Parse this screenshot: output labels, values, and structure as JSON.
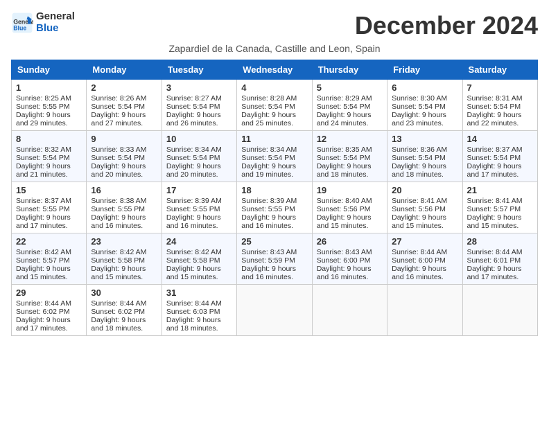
{
  "header": {
    "logo_line1": "General",
    "logo_line2": "Blue",
    "month_title": "December 2024",
    "subtitle": "Zapardiel de la Canada, Castille and Leon, Spain"
  },
  "weekdays": [
    "Sunday",
    "Monday",
    "Tuesday",
    "Wednesday",
    "Thursday",
    "Friday",
    "Saturday"
  ],
  "weeks": [
    [
      {
        "day": "1",
        "rise": "8:25 AM",
        "set": "5:55 PM",
        "hours": "9 hours and 29 minutes."
      },
      {
        "day": "2",
        "rise": "8:26 AM",
        "set": "5:54 PM",
        "hours": "9 hours and 27 minutes."
      },
      {
        "day": "3",
        "rise": "8:27 AM",
        "set": "5:54 PM",
        "hours": "9 hours and 26 minutes."
      },
      {
        "day": "4",
        "rise": "8:28 AM",
        "set": "5:54 PM",
        "hours": "9 hours and 25 minutes."
      },
      {
        "day": "5",
        "rise": "8:29 AM",
        "set": "5:54 PM",
        "hours": "9 hours and 24 minutes."
      },
      {
        "day": "6",
        "rise": "8:30 AM",
        "set": "5:54 PM",
        "hours": "9 hours and 23 minutes."
      },
      {
        "day": "7",
        "rise": "8:31 AM",
        "set": "5:54 PM",
        "hours": "9 hours and 22 minutes."
      }
    ],
    [
      {
        "day": "8",
        "rise": "8:32 AM",
        "set": "5:54 PM",
        "hours": "9 hours and 21 minutes."
      },
      {
        "day": "9",
        "rise": "8:33 AM",
        "set": "5:54 PM",
        "hours": "9 hours and 20 minutes."
      },
      {
        "day": "10",
        "rise": "8:34 AM",
        "set": "5:54 PM",
        "hours": "9 hours and 20 minutes."
      },
      {
        "day": "11",
        "rise": "8:34 AM",
        "set": "5:54 PM",
        "hours": "9 hours and 19 minutes."
      },
      {
        "day": "12",
        "rise": "8:35 AM",
        "set": "5:54 PM",
        "hours": "9 hours and 18 minutes."
      },
      {
        "day": "13",
        "rise": "8:36 AM",
        "set": "5:54 PM",
        "hours": "9 hours and 18 minutes."
      },
      {
        "day": "14",
        "rise": "8:37 AM",
        "set": "5:54 PM",
        "hours": "9 hours and 17 minutes."
      }
    ],
    [
      {
        "day": "15",
        "rise": "8:37 AM",
        "set": "5:55 PM",
        "hours": "9 hours and 17 minutes."
      },
      {
        "day": "16",
        "rise": "8:38 AM",
        "set": "5:55 PM",
        "hours": "9 hours and 16 minutes."
      },
      {
        "day": "17",
        "rise": "8:39 AM",
        "set": "5:55 PM",
        "hours": "9 hours and 16 minutes."
      },
      {
        "day": "18",
        "rise": "8:39 AM",
        "set": "5:55 PM",
        "hours": "9 hours and 16 minutes."
      },
      {
        "day": "19",
        "rise": "8:40 AM",
        "set": "5:56 PM",
        "hours": "9 hours and 15 minutes."
      },
      {
        "day": "20",
        "rise": "8:41 AM",
        "set": "5:56 PM",
        "hours": "9 hours and 15 minutes."
      },
      {
        "day": "21",
        "rise": "8:41 AM",
        "set": "5:57 PM",
        "hours": "9 hours and 15 minutes."
      }
    ],
    [
      {
        "day": "22",
        "rise": "8:42 AM",
        "set": "5:57 PM",
        "hours": "9 hours and 15 minutes."
      },
      {
        "day": "23",
        "rise": "8:42 AM",
        "set": "5:58 PM",
        "hours": "9 hours and 15 minutes."
      },
      {
        "day": "24",
        "rise": "8:42 AM",
        "set": "5:58 PM",
        "hours": "9 hours and 15 minutes."
      },
      {
        "day": "25",
        "rise": "8:43 AM",
        "set": "5:59 PM",
        "hours": "9 hours and 16 minutes."
      },
      {
        "day": "26",
        "rise": "8:43 AM",
        "set": "6:00 PM",
        "hours": "9 hours and 16 minutes."
      },
      {
        "day": "27",
        "rise": "8:44 AM",
        "set": "6:00 PM",
        "hours": "9 hours and 16 minutes."
      },
      {
        "day": "28",
        "rise": "8:44 AM",
        "set": "6:01 PM",
        "hours": "9 hours and 17 minutes."
      }
    ],
    [
      {
        "day": "29",
        "rise": "8:44 AM",
        "set": "6:02 PM",
        "hours": "9 hours and 17 minutes."
      },
      {
        "day": "30",
        "rise": "8:44 AM",
        "set": "6:02 PM",
        "hours": "9 hours and 18 minutes."
      },
      {
        "day": "31",
        "rise": "8:44 AM",
        "set": "6:03 PM",
        "hours": "9 hours and 18 minutes."
      },
      null,
      null,
      null,
      null
    ]
  ],
  "labels": {
    "sunrise": "Sunrise:",
    "sunset": "Sunset:",
    "daylight": "Daylight:"
  }
}
